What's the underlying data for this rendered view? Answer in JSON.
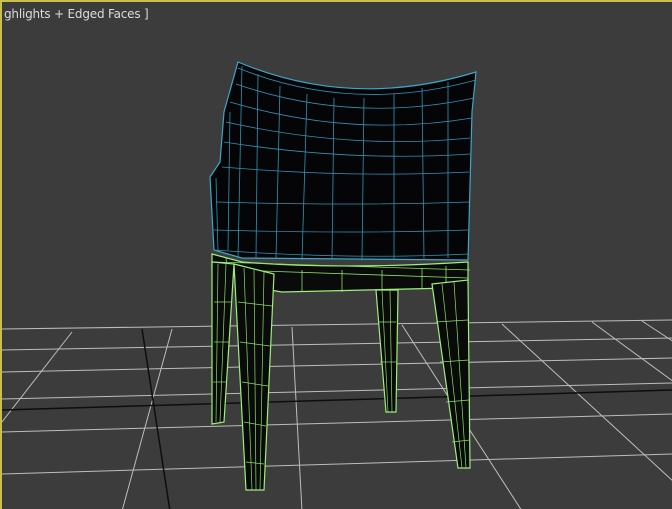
{
  "viewport": {
    "label": "ghlights + Edged Faces ]",
    "border_color": "#c8c04a",
    "background": "#3c3c3c",
    "grid_color": "#c8c8c8",
    "grid_major_color": "#141414",
    "selected_wire_color": "#3aa8c8",
    "legs_wire_color": "#9ef07a",
    "model_fill": "#050508"
  }
}
